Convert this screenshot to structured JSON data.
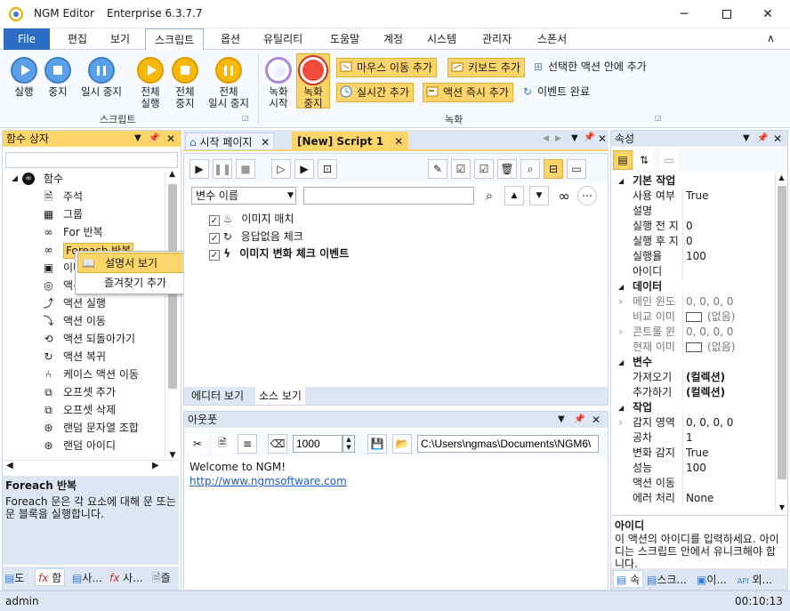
{
  "window": {
    "app": "NGM Editor",
    "edition": "Enterprise 6.3.7.7"
  },
  "menu": {
    "file": "File",
    "tabs": [
      "편집",
      "보기",
      "스크립트",
      "옵션",
      "유틸리티",
      "도움말",
      "계정",
      "시스템",
      "관리자",
      "스폰서"
    ],
    "active_tab": "스크립트"
  },
  "ribbon": {
    "script_group": "스크립트",
    "run": "실행",
    "stop": "중지",
    "pause": "일시 중지",
    "run_all": [
      "전체",
      "실행"
    ],
    "stop_all": [
      "전체",
      "중지"
    ],
    "pause_all": [
      "전체",
      "일시 중지"
    ],
    "record_group": "녹화",
    "record_start": [
      "녹화",
      "시작"
    ],
    "record_stop": [
      "녹화",
      "중지"
    ],
    "mouse_move": "마우스 이동 추가",
    "keyboard": "키보드 추가",
    "inside_action": "선택한 액션 안에 추가",
    "realtime": "실시간 추가",
    "action_now": "액션 즉시 추가",
    "event_done": "이벤트 완료"
  },
  "left_panel": {
    "title": "함수 상자",
    "search_placeholder": "",
    "root": "함수",
    "items": [
      "주석",
      "그룹",
      "For 반복",
      "Foreach 반복",
      "이미",
      "액션",
      "액션 실행",
      "액션 이동",
      "액션 되돌아가기",
      "액션 복귀",
      "케이스 액션 이동",
      "오프셋 추가",
      "오프셋 삭제",
      "랜덤 문자열 조합",
      "랜덤 아이디"
    ],
    "desc_title": "Foreach 반복",
    "desc_body": "Foreach 문은 각 요소에 대해 문 또는 문 블록을 실행합니다.",
    "bottom_tabs": [
      "도",
      "함",
      "사...",
      "사...",
      "즐"
    ]
  },
  "context_menu": {
    "items": [
      "설명서 보기",
      "즐겨찾기 추가"
    ]
  },
  "doc_tabs": {
    "start": "시작 페이지",
    "script": "[New] Script 1"
  },
  "editor": {
    "var_select": "변수 이름",
    "items": [
      {
        "label": "이미지 매치",
        "checked": true
      },
      {
        "label": "응답없음 체크",
        "checked": true
      },
      {
        "label": "이미지 변화 체크 이벤트",
        "checked": true
      }
    ],
    "tabs": [
      "에디터 보기",
      "소스 보기"
    ]
  },
  "output": {
    "title": "아웃풋",
    "value": "1000",
    "path": "C:\\Users\\ngmas\\Documents\\NGM6\\",
    "line1": "Welcome to NGM!",
    "link": "http://www.ngmsoftware.com"
  },
  "props": {
    "title": "속성",
    "rows": [
      {
        "cat": true,
        "name": "기본 작업"
      },
      {
        "name": "사용 여부",
        "val": "True"
      },
      {
        "name": "설명",
        "val": ""
      },
      {
        "name": "실행 전 지",
        "val": "0"
      },
      {
        "name": "실행 후 지",
        "val": "0"
      },
      {
        "name": "실행율",
        "val": "100"
      },
      {
        "name": "아이디",
        "val": ""
      },
      {
        "cat": true,
        "name": "데이터"
      },
      {
        "name": "메인 윈도",
        "val": "0, 0, 0, 0",
        "gray": true,
        "exp": true
      },
      {
        "name": "비교 이미",
        "val": "(없음)",
        "gray": true,
        "swatch": true
      },
      {
        "name": "콘트롤 윈",
        "val": "0, 0, 0, 0",
        "gray": true,
        "exp": true
      },
      {
        "name": "현재 이미",
        "val": "(없음)",
        "gray": true,
        "swatch": true
      },
      {
        "cat": true,
        "name": "변수"
      },
      {
        "name": "가져오기",
        "val": "(컬렉션)",
        "bold": true
      },
      {
        "name": "추가하기",
        "val": "(컬렉션)",
        "bold": true
      },
      {
        "cat": true,
        "name": "작업"
      },
      {
        "name": "감지 영역",
        "val": "0, 0, 0, 0",
        "exp": true
      },
      {
        "name": "공차",
        "val": "1"
      },
      {
        "name": "변화 감지",
        "val": "True"
      },
      {
        "name": "성능",
        "val": "100"
      },
      {
        "name": "액션 이동",
        "val": ""
      },
      {
        "name": "에러 처리",
        "val": "None"
      }
    ],
    "desc_title": "아이디",
    "desc_body": "이 액션의 아이디를 입력하세요. 아이디는 스크립트 안에서 유니크해야 합니다.",
    "bottom_tabs": [
      "속",
      "스크...",
      "이...",
      "외..."
    ]
  },
  "status": {
    "user": "admin",
    "time": "00:10:13"
  },
  "colors": {
    "accent": "#2b6cc4",
    "highlight": "#fbd56a",
    "panel_head": "#dde6f2"
  }
}
